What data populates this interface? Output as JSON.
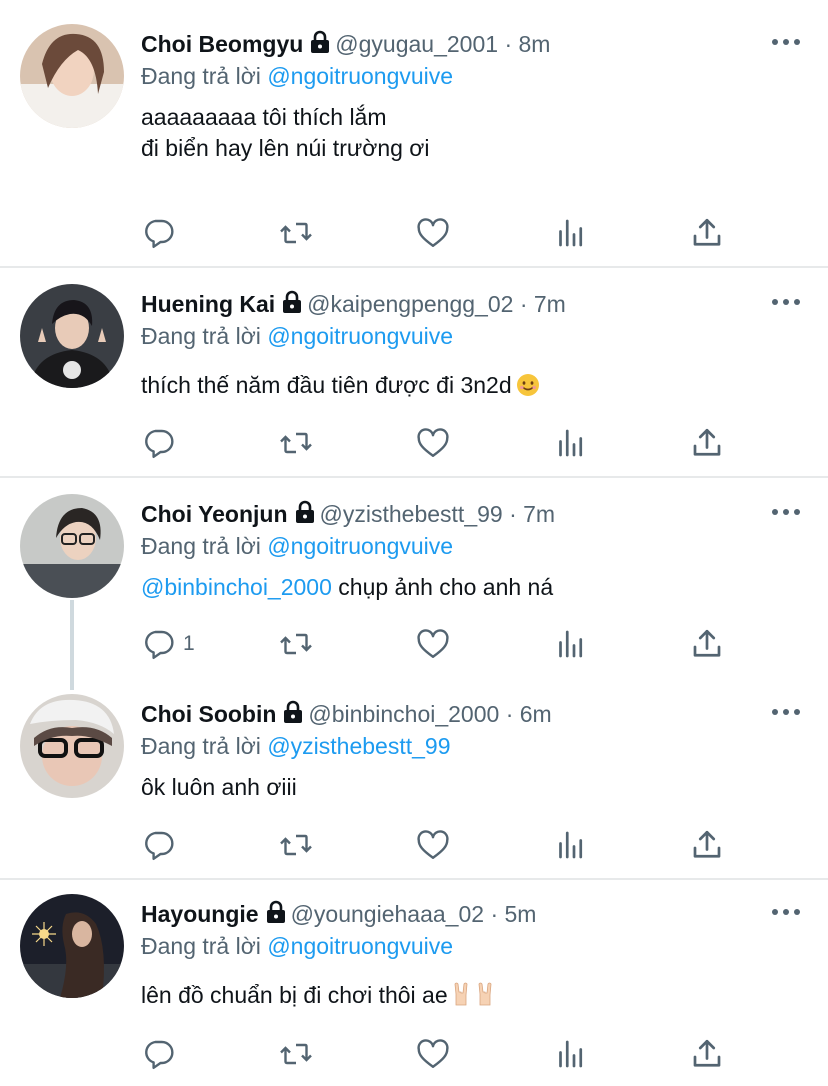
{
  "reply_prefix": "Đang trả lời",
  "actions": {
    "reply_icon": "reply-icon",
    "retweet_icon": "retweet-icon",
    "like_icon": "heart-icon",
    "views_icon": "analytics-icon",
    "share_icon": "share-icon"
  },
  "colors": {
    "accent": "#1d9bf0",
    "meta": "#536471",
    "text": "#0f1419",
    "divider": "#e7e9ea"
  },
  "tweets": [
    {
      "name": "Choi Beomgyu",
      "handle": "@gyugau_2001",
      "time": "· 8m",
      "reply_to": "@ngoitruongvuive",
      "text_line1": "aaaaaaaaa tôi thích lắm",
      "text_line2": "đi biển hay lên núi trường ơi"
    },
    {
      "name": "Huening Kai",
      "handle": "@kaipengpengg_02",
      "time": "· 7m",
      "reply_to": "@ngoitruongvuive",
      "text": "thích thế năm đầu tiên được đi 3n2d",
      "emoji": "smiling-face-emoji"
    },
    {
      "name": "Choi Yeonjun",
      "handle": "@yzisthebestt_99",
      "time": "· 7m",
      "reply_to": "@ngoitruongvuive",
      "mention": "@binbinchoi_2000",
      "text": " chụp ảnh cho anh ná",
      "reply_count": "1"
    },
    {
      "name": "Choi Soobin",
      "handle": "@binbinchoi_2000",
      "time": "· 6m",
      "reply_to": "@yzisthebestt_99",
      "text": "ôk luôn anh ơiii"
    },
    {
      "name": "Hayoungie",
      "handle": "@youngiehaaa_02",
      "time": "· 5m",
      "reply_to": "@ngoitruongvuive",
      "text": "lên đồ chuẩn bị đi chơi thôi ae",
      "emoji": "sign-of-horns-emoji"
    }
  ]
}
